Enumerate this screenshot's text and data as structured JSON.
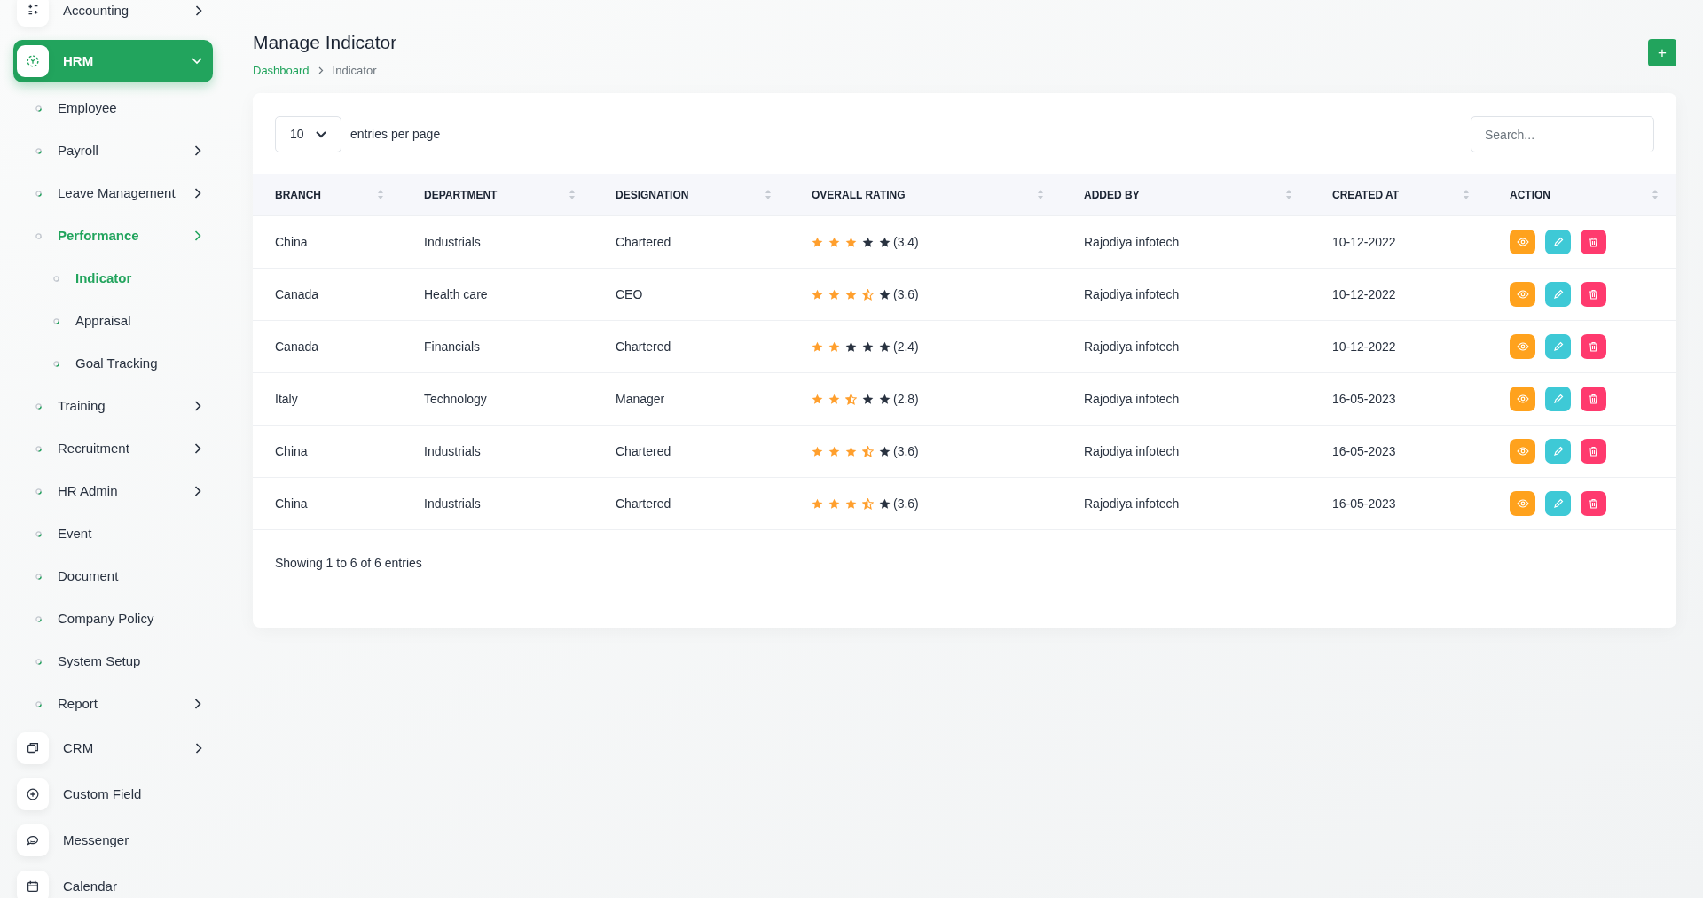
{
  "sidebar": {
    "items": [
      {
        "label": "Accounting",
        "selected": false,
        "expanded": false
      },
      {
        "label": "HRM",
        "selected": true,
        "expanded": true,
        "children": [
          {
            "label": "Employee",
            "selected": false
          },
          {
            "label": "Payroll",
            "selected": false,
            "expanded": false
          },
          {
            "label": "Leave Management",
            "selected": false,
            "expanded": false
          },
          {
            "label": "Performance",
            "selected": true,
            "expanded": false,
            "children": [
              {
                "label": "Indicator",
                "selected": true
              },
              {
                "label": "Appraisal",
                "selected": false
              },
              {
                "label": "Goal Tracking",
                "selected": false
              }
            ]
          },
          {
            "label": "Training",
            "selected": false,
            "expanded": false
          },
          {
            "label": "Recruitment",
            "selected": false,
            "expanded": false
          },
          {
            "label": "HR Admin",
            "selected": false,
            "expanded": false
          },
          {
            "label": "Event",
            "selected": false
          },
          {
            "label": "Document",
            "selected": false
          },
          {
            "label": "Company Policy",
            "selected": false
          },
          {
            "label": "System Setup",
            "selected": false
          },
          {
            "label": "Report",
            "selected": false,
            "expanded": false
          }
        ]
      },
      {
        "label": "CRM",
        "selected": false,
        "expanded": false
      },
      {
        "label": "Custom Field",
        "selected": false
      },
      {
        "label": "Messenger",
        "selected": false
      },
      {
        "label": "Calendar",
        "selected": false
      }
    ]
  },
  "page": {
    "title": "Manage Indicator",
    "breadcrumb": [
      "Dashboard",
      "Indicator"
    ],
    "add_button": "+"
  },
  "table": {
    "page_size": "10",
    "page_size_label": "entries per page",
    "search_placeholder": "Search...",
    "columns": [
      "BRANCH",
      "DEPARTMENT",
      "DESIGNATION",
      "OVERALL RATING",
      "ADDED BY",
      "CREATED AT",
      "ACTION"
    ],
    "rows": [
      {
        "branch": "China",
        "department": "Industrials",
        "designation": "Chartered",
        "stars": 3,
        "rating": "(3.4)",
        "added_by": "Rajodiya infotech",
        "created_at": "10-12-2022"
      },
      {
        "branch": "Canada",
        "department": "Health care",
        "designation": "CEO",
        "stars": 3.5,
        "rating": "(3.6)",
        "added_by": "Rajodiya infotech",
        "created_at": "10-12-2022"
      },
      {
        "branch": "Canada",
        "department": "Financials",
        "designation": "Chartered",
        "stars": 2,
        "rating": "(2.4)",
        "added_by": "Rajodiya infotech",
        "created_at": "10-12-2022"
      },
      {
        "branch": "Italy",
        "department": "Technology",
        "designation": "Manager",
        "stars": 2.5,
        "rating": "(2.8)",
        "added_by": "Rajodiya infotech",
        "created_at": "16-05-2023"
      },
      {
        "branch": "China",
        "department": "Industrials",
        "designation": "Chartered",
        "stars": 3.5,
        "rating": "(3.6)",
        "added_by": "Rajodiya infotech",
        "created_at": "16-05-2023"
      },
      {
        "branch": "China",
        "department": "Industrials",
        "designation": "Chartered",
        "stars": 3.5,
        "rating": "(3.6)",
        "added_by": "Rajodiya infotech",
        "created_at": "16-05-2023"
      }
    ],
    "footer": "Showing 1 to 6 of 6 entries"
  }
}
